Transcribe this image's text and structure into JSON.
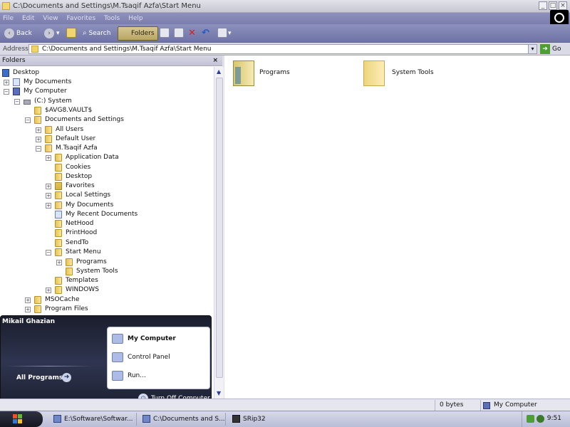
{
  "window": {
    "title": "C:\\Documents and Settings\\M.Tsaqif Azfa\\Start Menu",
    "min": "_",
    "max": "□",
    "close": "×"
  },
  "menubar": {
    "items": [
      "File",
      "Edit",
      "View",
      "Favorites",
      "Tools",
      "Help"
    ]
  },
  "toolbar": {
    "back": "Back",
    "forward": "›",
    "search": "Search",
    "folders": "Folders"
  },
  "address": {
    "label": "Address",
    "value": "C:\\Documents and Settings\\M.Tsaqif Azfa\\Start Menu",
    "go": "Go"
  },
  "folder_pane": {
    "title": "Folders",
    "close": "×",
    "tree": [
      {
        "label": "Desktop"
      },
      {
        "label": "My Documents"
      },
      {
        "label": "My Computer"
      },
      {
        "label": "(C:) System"
      },
      {
        "label": "$AVG8.VAULT$"
      },
      {
        "label": "Documents and Settings"
      },
      {
        "label": "All Users"
      },
      {
        "label": "Default User"
      },
      {
        "label": "M.Tsaqif Azfa"
      },
      {
        "label": "Application Data"
      },
      {
        "label": "Cookies"
      },
      {
        "label": "Desktop"
      },
      {
        "label": "Favorites"
      },
      {
        "label": "Local Settings"
      },
      {
        "label": "My Documents"
      },
      {
        "label": "My Recent Documents"
      },
      {
        "label": "NetHood"
      },
      {
        "label": "PrintHood"
      },
      {
        "label": "SendTo"
      },
      {
        "label": "Start Menu"
      },
      {
        "label": "Programs"
      },
      {
        "label": "System Tools"
      },
      {
        "label": "Templates"
      },
      {
        "label": "WINDOWS"
      },
      {
        "label": "MSOCache"
      },
      {
        "label": "Program Files"
      }
    ]
  },
  "content": {
    "items": [
      {
        "label": "Programs"
      },
      {
        "label": "System Tools"
      }
    ]
  },
  "start_menu": {
    "user": "Mikail Ghazian",
    "all_programs": "All Programs",
    "items": [
      "My Computer",
      "Control Panel",
      "Run..."
    ],
    "turn_off": "Turn Off Computer"
  },
  "statusbar": {
    "size": "0 bytes",
    "location": "My Computer"
  },
  "taskbar": {
    "tasks": [
      "E:\\Software\\Softwar...",
      "C:\\Documents and S...",
      "SRip32"
    ],
    "clock": "9:51"
  }
}
